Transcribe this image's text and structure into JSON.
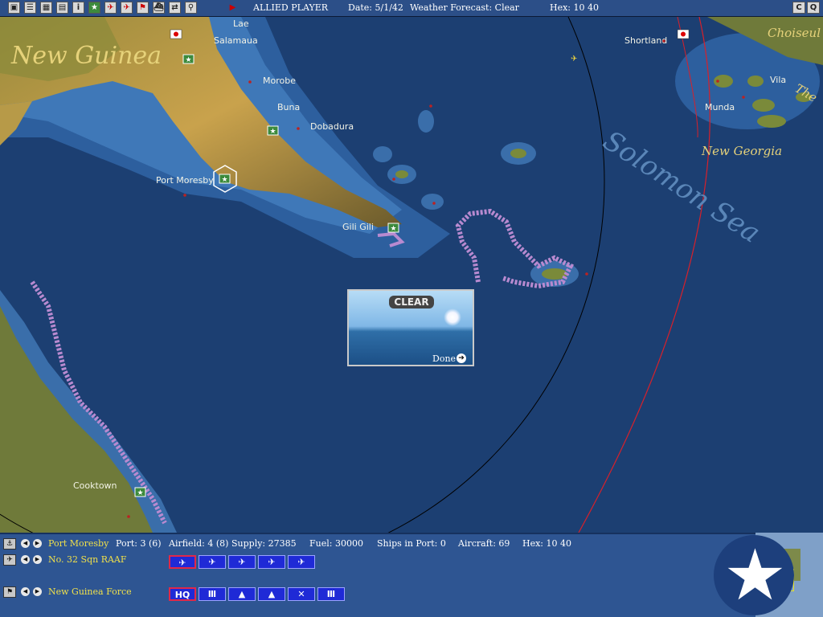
{
  "toolbar": {
    "player": "ALLIED PLAYER",
    "date": "Date:  5/1/42",
    "weather": "Weather Forecast: Clear",
    "hex": "Hex: 10 40",
    "btn_c": "C",
    "btn_q": "Q"
  },
  "map": {
    "places": {
      "lae": "Lae",
      "salamaua": "Salamaua",
      "morobe": "Morobe",
      "buna": "Buna",
      "dobadura": "Dobadura",
      "port_moresby": "Port Moresby",
      "gili_gili": "Gili Gili",
      "cooktown": "Cooktown",
      "shortland": "Shortland",
      "vila": "Vila",
      "munda": "Munda",
      "choiseul": "Choiseul",
      "the": "The"
    },
    "regions": {
      "new_guinea": "New Guinea",
      "new_georgia": "New Georgia",
      "solomon_sea": "Solomon Sea"
    }
  },
  "weather_popup": {
    "title": "CLEAR",
    "done": "Done"
  },
  "info_bar": {
    "base": "Port Moresby",
    "port": "Port: 3 (6)",
    "airfield": "Airfield: 4 (8)",
    "supply": "Supply: 27385",
    "fuel": "Fuel: 30000",
    "ships": "Ships in Port: 0",
    "aircraft": "Aircraft: 69",
    "hex": "Hex: 10 40",
    "squadron": "No. 32 Sqn RAAF",
    "force": "New Guinea Force",
    "hq_label": "HQ"
  },
  "colors": {
    "deep_sea": "#1c3f72",
    "shallow": "#4f86c4",
    "land_light": "#c8a24a",
    "land_dark": "#6b5a2a",
    "panel": "#2e5592",
    "accent_yellow": "#f0e04a",
    "range_red": "#d8202a"
  }
}
